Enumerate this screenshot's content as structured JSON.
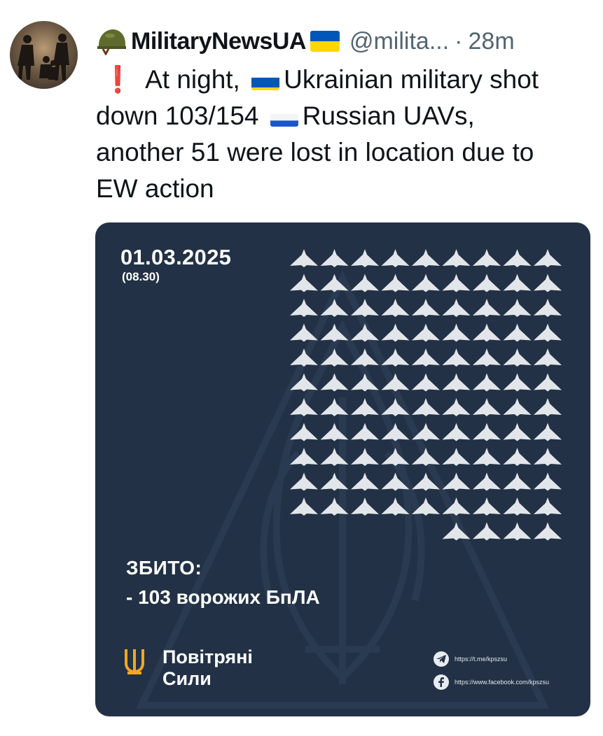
{
  "tweet": {
    "display_name": "MilitaryNewsUA",
    "handle": "@milita...",
    "separator": "·",
    "time": "28m",
    "text_lines": {
      "l1a": "At night,",
      "l1b": "Ukrainian military shot",
      "l2a": "down 103/154",
      "l2b": "Russian UAVs,",
      "l3": "another 51 were lost in location due to",
      "l4": "EW action"
    },
    "emoji": {
      "helmet": "military-helmet-icon",
      "exclamation": "❗",
      "flag_ua": "ukraine-flag-icon",
      "flag_ru": "russia-flag-icon"
    }
  },
  "card": {
    "date": "01.03.2025",
    "time": "(08.30)",
    "shot_label": "ЗБИТО:",
    "shot_count": "- 103 ворожих БпЛА",
    "brand_line1": "Повітряні",
    "brand_line2": "Сили",
    "telegram_url": "https://t.me/kpszsu",
    "facebook_url": "https://www.facebook.com/kpszsu",
    "drone_count": 103,
    "drone_icon": "shahed-drone-icon"
  },
  "colors": {
    "card_bg": "#223145",
    "drone": "#e2e6ea",
    "accent_orange": "#f5a623",
    "muted_text": "#536471",
    "flag_blue": "#0057b7",
    "flag_yellow": "#ffd700"
  }
}
